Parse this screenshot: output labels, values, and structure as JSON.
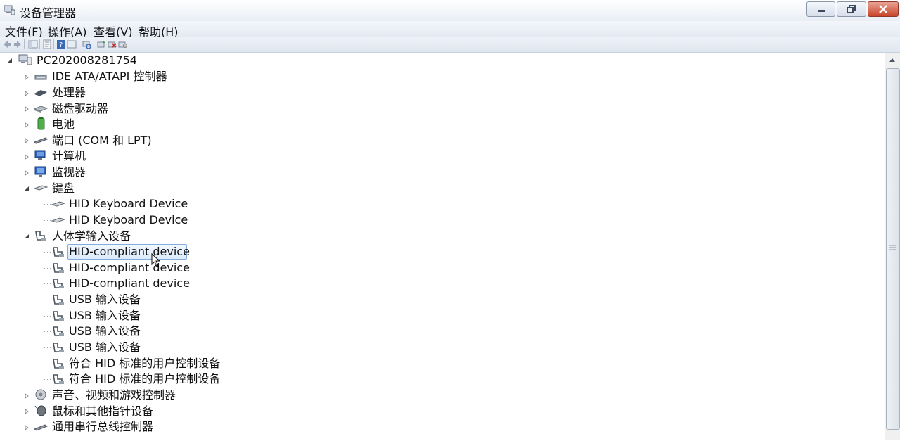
{
  "window": {
    "title": "设备管理器"
  },
  "menu": {
    "items": [
      "文件(F)",
      "操作(A)",
      "查看(V)",
      "帮助(H)"
    ]
  },
  "tree": {
    "root": "PC202008281754",
    "categories": [
      {
        "label": "IDE ATA/ATAPI 控制器",
        "icon": "ide-controller-icon",
        "expanded": false
      },
      {
        "label": "处理器",
        "icon": "processor-icon",
        "expanded": false
      },
      {
        "label": "磁盘驱动器",
        "icon": "disk-drive-icon",
        "expanded": false
      },
      {
        "label": "电池",
        "icon": "battery-icon",
        "expanded": false
      },
      {
        "label": "端口 (COM 和 LPT)",
        "icon": "port-icon",
        "expanded": false
      },
      {
        "label": "计算机",
        "icon": "computer-icon",
        "expanded": false
      },
      {
        "label": "监视器",
        "icon": "monitor-icon",
        "expanded": false
      },
      {
        "label": "键盘",
        "icon": "keyboard-icon",
        "expanded": true,
        "children": [
          "HID Keyboard Device",
          "HID Keyboard Device"
        ]
      },
      {
        "label": "人体学输入设备",
        "icon": "hid-icon",
        "expanded": true,
        "children": [
          "HID-compliant device",
          "HID-compliant device",
          "HID-compliant device",
          "USB 输入设备",
          "USB 输入设备",
          "USB 输入设备",
          "USB 输入设备",
          "符合 HID 标准的用户控制设备",
          "符合 HID 标准的用户控制设备"
        ]
      },
      {
        "label": "声音、视频和游戏控制器",
        "icon": "sound-icon",
        "expanded": false
      },
      {
        "label": "鼠标和其他指针设备",
        "icon": "mouse-icon",
        "expanded": false
      },
      {
        "label": "通用串行总线控制器",
        "icon": "usb-controller-icon",
        "expanded": false
      }
    ]
  }
}
